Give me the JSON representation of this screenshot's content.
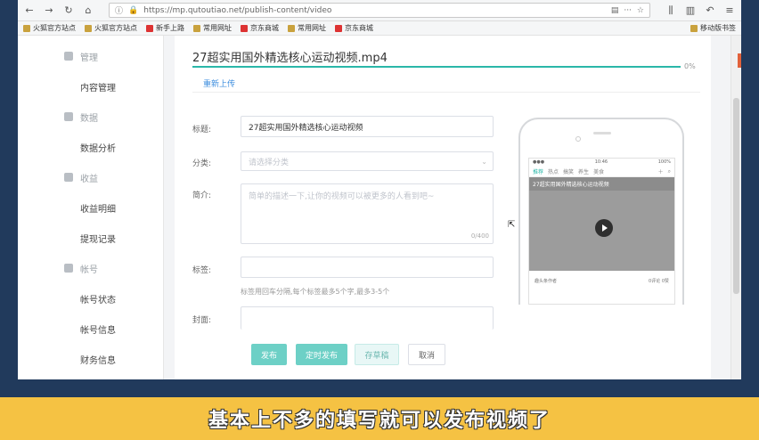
{
  "browser": {
    "url": "https://mp.qutoutiao.net/publish-content/video",
    "menu_icons": [
      "reader-icon",
      "more-icon",
      "bookmark-star-icon"
    ],
    "bookmarks": [
      "火狐官方站点",
      "火狐官方站点",
      "新手上路",
      "常用网址",
      "京东商城",
      "常用网址",
      "京东商城"
    ],
    "bookmarks_right": "移动版书签"
  },
  "sidebar": {
    "items": [
      {
        "type": "group",
        "label": "管理"
      },
      {
        "type": "item",
        "label": "内容管理"
      },
      {
        "type": "group",
        "label": "数据"
      },
      {
        "type": "item",
        "label": "数据分析"
      },
      {
        "type": "group",
        "label": "收益"
      },
      {
        "type": "item",
        "label": "收益明细"
      },
      {
        "type": "item",
        "label": "提现记录"
      },
      {
        "type": "group",
        "label": "帐号"
      },
      {
        "type": "item",
        "label": "帐号状态"
      },
      {
        "type": "item",
        "label": "帐号信息"
      },
      {
        "type": "item",
        "label": "财务信息"
      }
    ]
  },
  "upload": {
    "file_name": "27超实用国外精选核心运动视频.mp4",
    "progress_percent": 100,
    "progress_label": "0%",
    "reupload_label": "重新上传"
  },
  "form": {
    "title_label": "标题:",
    "title_value": "27超实用国外精选核心运动视频",
    "category_label": "分类:",
    "category_placeholder": "请选择分类",
    "intro_label": "简介:",
    "intro_placeholder": "简单的描述一下,让你的视频可以被更多的人看到吧~",
    "intro_count": "0/400",
    "tags_label": "标签:",
    "tags_hint": "标签用回车分隔,每个标签最多5个字,最多3-5个",
    "cover_label": "封面:"
  },
  "buttons": {
    "publish": "发布",
    "schedule": "定时发布",
    "draft": "存草稿",
    "cancel": "取消"
  },
  "preview": {
    "status_left": "●●●",
    "status_mid": "10:46",
    "status_right": "100%",
    "tabs": [
      "推荐",
      "热点",
      "搞笑",
      "养生",
      "美食"
    ],
    "active_tab": 0,
    "video_title": "27超实用国外精选核心运动视频",
    "author": "趣头条作者",
    "footer_right": "0评论 0赞"
  },
  "caption": "基本上不多的填写就可以发布视频了"
}
